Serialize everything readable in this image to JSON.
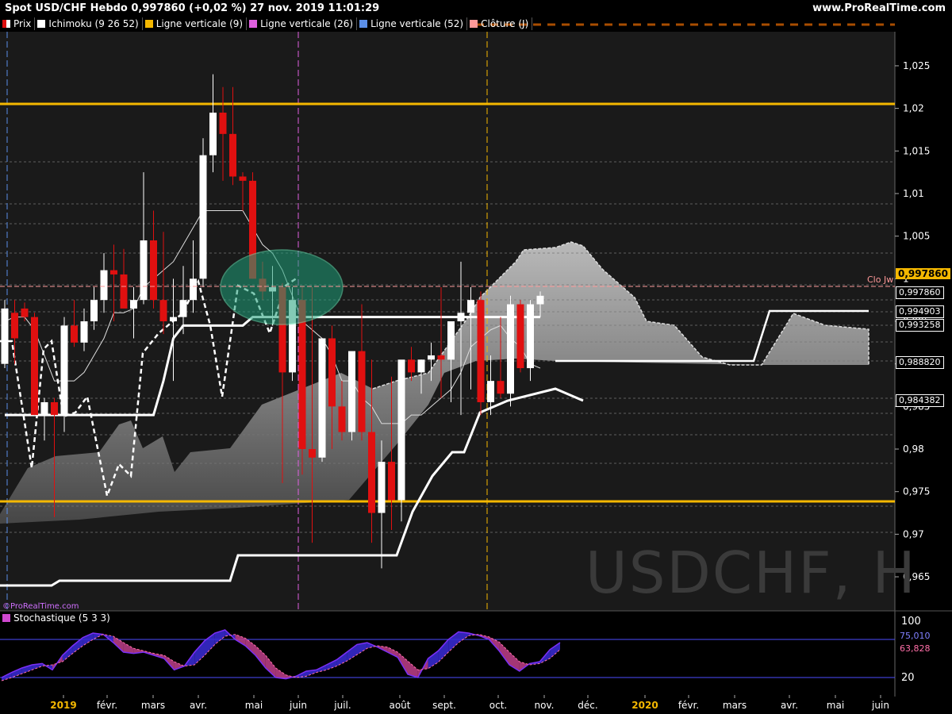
{
  "header": {
    "title": "Spot USD/CHF Hebdo 0,997860 (+0,02 %) 27 nov. 2019 11:01:29",
    "site": "www.ProRealTime.com"
  },
  "legend": [
    {
      "label": "Prix",
      "color": "#ffffff",
      "color2": "#e01010"
    },
    {
      "label": "Ichimoku (9 26 52)",
      "color": "#ffffff"
    },
    {
      "label": "Ligne verticale (9)",
      "color": "#f5b800"
    },
    {
      "label": "Ligne verticale (26)",
      "color": "#e060e0"
    },
    {
      "label": "Ligne verticale (52)",
      "color": "#5b8fe8"
    },
    {
      "label": "Clôture (J)",
      "color": "#ff9999"
    }
  ],
  "watermark": "USDCHF, H",
  "site_small": "ProRealTime.com",
  "stoch_label": "Stochastique (5 3 3)",
  "badges": {
    "last": "0,997860",
    "l1": "0,997860",
    "l2": "0,994903",
    "l3": "0,993258",
    "l4": "0,988820",
    "l5": "0,984382",
    "clo": "Clo Jw",
    "stoch_k": "75,010",
    "stoch_d": "63,828"
  },
  "colors": {
    "bull": "#ffffff",
    "bear": "#e01010",
    "hline": "#f5b800",
    "cloud": "#bbbbbb",
    "kumo_line": "#ffffff",
    "stoch_k": "#7b2ff7",
    "stoch_d": "#ff6fa8",
    "stoch_band": "#4d4dff"
  },
  "chart_data": [
    {
      "type": "candlestick",
      "title": "Spot USD/CHF Hebdo",
      "ylim": [
        0.961,
        1.029
      ],
      "yticks": [
        0.965,
        0.97,
        0.975,
        0.98,
        0.985,
        0.99,
        0.995,
        1.0,
        1.005,
        1.01,
        1.015,
        1.02,
        1.025
      ],
      "ytick_labels": [
        "0,965",
        "0,97",
        "0,975",
        "0,98",
        "0,985",
        "0,99",
        "0,995",
        "1",
        "1,005",
        "1,01",
        "1,015",
        "1,02",
        "1,025"
      ],
      "x_labels": [
        "2019",
        "févr.",
        "mars",
        "avr.",
        "mai",
        "juin",
        "juil.",
        "août",
        "sept.",
        "oct.",
        "nov.",
        "déc.",
        "2020",
        "févr.",
        "mars",
        "avr.",
        "mai",
        "juin"
      ],
      "x_label_bold": [
        "2019",
        "2020"
      ],
      "ohlc": [
        [
          0.99,
          0.9975,
          0.9895,
          0.9965
        ],
        [
          0.996,
          0.9975,
          0.99,
          0.993
        ],
        [
          0.9965,
          0.9972,
          0.995,
          0.9955
        ],
        [
          0.9955,
          0.996,
          0.984,
          0.984
        ],
        [
          0.984,
          0.986,
          0.981,
          0.9855
        ],
        [
          0.9855,
          0.986,
          0.972,
          0.984
        ],
        [
          0.984,
          0.9955,
          0.982,
          0.9945
        ],
        [
          0.9945,
          0.9975,
          0.992,
          0.9925
        ],
        [
          0.9925,
          0.9965,
          0.9915,
          0.995
        ],
        [
          0.995,
          0.999,
          0.994,
          0.9975
        ],
        [
          0.9975,
          1.003,
          0.996,
          1.001
        ],
        [
          1.001,
          1.004,
          0.995,
          1.0005
        ],
        [
          1.0005,
          1.0035,
          0.997,
          0.9965
        ],
        [
          0.9965,
          0.999,
          0.993,
          0.9975
        ],
        [
          0.9975,
          1.0125,
          0.997,
          1.0045
        ],
        [
          1.0045,
          1.008,
          0.9965,
          0.9975
        ],
        [
          0.9975,
          1.0055,
          0.9935,
          0.995
        ],
        [
          0.995,
          1.0,
          0.988,
          0.9955
        ],
        [
          0.9955,
          1.0015,
          0.9935,
          0.9975
        ],
        [
          0.9975,
          1.0045,
          0.996,
          1.0
        ],
        [
          1.0,
          1.0165,
          0.999,
          1.0145
        ],
        [
          1.0145,
          1.024,
          1.0125,
          1.0195
        ],
        [
          1.0195,
          1.0225,
          1.0115,
          1.017
        ],
        [
          1.017,
          1.0225,
          1.011,
          1.012
        ],
        [
          1.012,
          1.0125,
          1.008,
          1.0115
        ],
        [
          1.0115,
          1.0125,
          1.0,
          1.0
        ],
        [
          1.0,
          1.002,
          0.9975,
          0.9985
        ],
        [
          0.9985,
          1.0015,
          0.9945,
          0.999
        ],
        [
          0.999,
          0.9995,
          0.976,
          0.989
        ],
        [
          0.989,
          0.999,
          0.988,
          0.9975
        ],
        [
          0.9975,
          0.999,
          0.977,
          0.98
        ],
        [
          0.98,
          0.999,
          0.969,
          0.979
        ],
        [
          0.979,
          0.993,
          0.9785,
          0.993
        ],
        [
          0.993,
          0.9945,
          0.98,
          0.985
        ],
        [
          0.985,
          0.988,
          0.981,
          0.982
        ],
        [
          0.982,
          0.988,
          0.981,
          0.9915
        ],
        [
          0.9915,
          0.997,
          0.981,
          0.982
        ],
        [
          0.982,
          0.9905,
          0.969,
          0.9725
        ],
        [
          0.9725,
          0.981,
          0.966,
          0.9785
        ],
        [
          0.9785,
          0.9885,
          0.9705,
          0.974
        ],
        [
          0.974,
          0.988,
          0.9715,
          0.9905
        ],
        [
          0.9905,
          0.992,
          0.988,
          0.989
        ],
        [
          0.989,
          0.9905,
          0.9865,
          0.9905
        ],
        [
          0.9905,
          0.9925,
          0.988,
          0.991
        ],
        [
          0.991,
          0.999,
          0.986,
          0.9905
        ],
        [
          0.9905,
          0.995,
          0.9855,
          0.995
        ],
        [
          0.995,
          1.002,
          0.984,
          0.996
        ],
        [
          0.996,
          0.999,
          0.987,
          0.9975
        ],
        [
          0.9975,
          0.9985,
          0.984,
          0.9855
        ],
        [
          0.9855,
          0.991,
          0.984,
          0.988
        ],
        [
          0.988,
          0.9955,
          0.986,
          0.9865
        ],
        [
          0.9865,
          0.998,
          0.985,
          0.997
        ],
        [
          0.997,
          0.9975,
          0.989,
          0.9895
        ],
        [
          0.9895,
          0.9975,
          0.988,
          0.997
        ],
        [
          0.997,
          0.9985,
          0.9955,
          0.998
        ]
      ],
      "kijun": [
        0.984,
        0.984,
        0.984,
        0.984,
        0.984,
        0.984,
        0.984,
        0.984,
        0.984,
        0.984,
        0.984,
        0.984,
        0.984,
        0.984,
        0.984,
        0.984,
        0.988,
        0.993,
        0.9945,
        0.9945,
        0.9945,
        0.9945,
        0.9945,
        0.9945,
        0.9945,
        0.9955,
        0.9955,
        0.9955,
        0.9955,
        0.9955,
        0.9955,
        0.9955,
        0.9955,
        0.9955,
        0.9955,
        0.9955,
        0.9955,
        0.9955,
        0.9955,
        0.9955,
        0.9955,
        0.9955,
        0.9955,
        0.9955,
        0.9955,
        0.9955,
        0.9955,
        0.9955,
        0.9955,
        0.9955,
        0.9955,
        0.9955,
        0.9955,
        0.9955,
        0.9955
      ],
      "tenkan": [
        0.995,
        0.9955,
        0.9955,
        0.994,
        0.991,
        0.988,
        0.988,
        0.988,
        0.989,
        0.991,
        0.993,
        0.996,
        0.996,
        0.9965,
        0.999,
        1.0,
        1.001,
        1.002,
        1.004,
        1.006,
        1.008,
        1.008,
        1.008,
        1.008,
        1.008,
        1.006,
        1.004,
        1.003,
        1.001,
        0.998,
        0.995,
        0.994,
        0.993,
        0.991,
        0.988,
        0.988,
        0.986,
        0.985,
        0.983,
        0.983,
        0.983,
        0.984,
        0.984,
        0.985,
        0.986,
        0.987,
        0.989,
        0.992,
        0.993,
        0.994,
        0.9945,
        0.993,
        0.992,
        0.99,
        0.9895
      ]
    },
    {
      "type": "line",
      "title": "Stochastique (5 3 3)",
      "ylim": [
        0,
        100
      ],
      "yticks": [
        20,
        80,
        100
      ],
      "ytick_labels": [
        "20",
        "",
        "100"
      ],
      "k": [
        20,
        28,
        35,
        40,
        42,
        32,
        55,
        70,
        83,
        90,
        88,
        75,
        60,
        58,
        60,
        55,
        50,
        32,
        38,
        60,
        78,
        90,
        95,
        80,
        70,
        55,
        35,
        20,
        18,
        22,
        30,
        32,
        40,
        48,
        60,
        72,
        75,
        68,
        60,
        52,
        25,
        20,
        50,
        62,
        80,
        92,
        90,
        86,
        80,
        62,
        40,
        30,
        42,
        45,
        64,
        75
      ],
      "d": [
        15,
        20,
        26,
        32,
        38,
        40,
        45,
        58,
        70,
        80,
        88,
        85,
        75,
        66,
        62,
        58,
        55,
        45,
        38,
        40,
        55,
        72,
        85,
        88,
        82,
        70,
        55,
        35,
        24,
        20,
        22,
        28,
        32,
        38,
        46,
        56,
        66,
        70,
        68,
        60,
        46,
        32,
        34,
        44,
        60,
        75,
        86,
        88,
        84,
        76,
        60,
        45,
        40,
        42,
        50,
        64
      ]
    }
  ]
}
